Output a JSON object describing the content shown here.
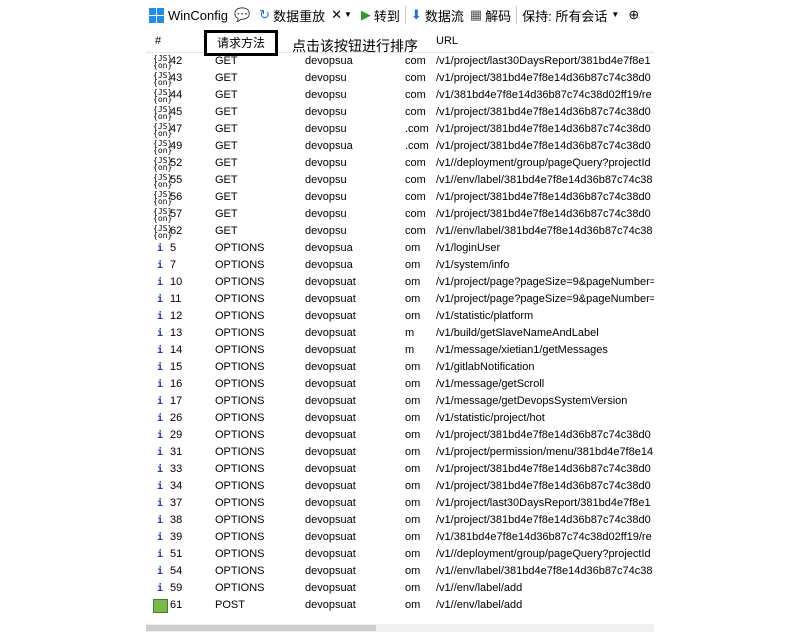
{
  "toolbar": {
    "winconfig": "WinConfig",
    "replay": "数据重放",
    "remove": "✕",
    "goto": "转到",
    "stream": "数据流",
    "decode": "解码",
    "keep": "保持: 所有会话"
  },
  "columns": {
    "num": "#",
    "method": "请求方法",
    "url": "URL"
  },
  "annotation": "点击该按钮进行排序",
  "rows": [
    {
      "icon": "json",
      "num": "42",
      "method": "GET",
      "host": "devopsua",
      "domain": "com",
      "url": "/v1/project/last30DaysReport/381bd4e7f8e1"
    },
    {
      "icon": "json",
      "num": "43",
      "method": "GET",
      "host": "devopsu",
      "domain": "com",
      "url": "/v1/project/381bd4e7f8e14d36b87c74c38d0"
    },
    {
      "icon": "json",
      "num": "44",
      "method": "GET",
      "host": "devopsu",
      "domain": "com",
      "url": "/v1/381bd4e7f8e14d36b87c74c38d02ff19/re"
    },
    {
      "icon": "json",
      "num": "45",
      "method": "GET",
      "host": "devopsu",
      "domain": "com",
      "url": "/v1/project/381bd4e7f8e14d36b87c74c38d0"
    },
    {
      "icon": "json",
      "num": "47",
      "method": "GET",
      "host": "devopsu",
      "domain": ".com",
      "url": "/v1/project/381bd4e7f8e14d36b87c74c38d0"
    },
    {
      "icon": "json",
      "num": "49",
      "method": "GET",
      "host": "devopsua",
      "domain": ".com",
      "url": "/v1/project/381bd4e7f8e14d36b87c74c38d0"
    },
    {
      "icon": "json",
      "num": "52",
      "method": "GET",
      "host": "devopsu",
      "domain": "com",
      "url": "/v1//deployment/group/pageQuery?projectId"
    },
    {
      "icon": "json",
      "num": "55",
      "method": "GET",
      "host": "devopsu",
      "domain": "com",
      "url": "/v1//env/label/381bd4e7f8e14d36b87c74c38"
    },
    {
      "icon": "json",
      "num": "56",
      "method": "GET",
      "host": "devopsu",
      "domain": "com",
      "url": "/v1/project/381bd4e7f8e14d36b87c74c38d0"
    },
    {
      "icon": "json",
      "num": "57",
      "method": "GET",
      "host": "devopsu",
      "domain": "com",
      "url": "/v1/project/381bd4e7f8e14d36b87c74c38d0"
    },
    {
      "icon": "json",
      "num": "62",
      "method": "GET",
      "host": "devopsu",
      "domain": "com",
      "url": "/v1//env/label/381bd4e7f8e14d36b87c74c38"
    },
    {
      "icon": "info",
      "num": "5",
      "method": "OPTIONS",
      "host": "devopsua",
      "domain": "om",
      "url": "/v1/loginUser"
    },
    {
      "icon": "info",
      "num": "7",
      "method": "OPTIONS",
      "host": "devopsua",
      "domain": "om",
      "url": "/v1/system/info"
    },
    {
      "icon": "info",
      "num": "10",
      "method": "OPTIONS",
      "host": "devopsuat",
      "domain": "om",
      "url": "/v1/project/page?pageSize=9&pageNumber="
    },
    {
      "icon": "info",
      "num": "11",
      "method": "OPTIONS",
      "host": "devopsuat",
      "domain": "om",
      "url": "/v1/project/page?pageSize=9&pageNumber="
    },
    {
      "icon": "info",
      "num": "12",
      "method": "OPTIONS",
      "host": "devopsuat",
      "domain": "om",
      "url": "/v1/statistic/platform"
    },
    {
      "icon": "info",
      "num": "13",
      "method": "OPTIONS",
      "host": "devopsuat",
      "domain": "m",
      "url": "/v1/build/getSlaveNameAndLabel"
    },
    {
      "icon": "info",
      "num": "14",
      "method": "OPTIONS",
      "host": "devopsuat",
      "domain": "m",
      "url": "/v1/message/xietian1/getMessages"
    },
    {
      "icon": "info",
      "num": "15",
      "method": "OPTIONS",
      "host": "devopsuat",
      "domain": "om",
      "url": "/v1/gitlabNotification"
    },
    {
      "icon": "info",
      "num": "16",
      "method": "OPTIONS",
      "host": "devopsuat",
      "domain": "om",
      "url": "/v1/message/getScroll"
    },
    {
      "icon": "info",
      "num": "17",
      "method": "OPTIONS",
      "host": "devopsuat",
      "domain": "om",
      "url": "/v1/message/getDevopsSystemVersion"
    },
    {
      "icon": "info",
      "num": "26",
      "method": "OPTIONS",
      "host": "devopsuat",
      "domain": "om",
      "url": "/v1/statistic/project/hot"
    },
    {
      "icon": "info",
      "num": "29",
      "method": "OPTIONS",
      "host": "devopsuat",
      "domain": "om",
      "url": "/v1/project/381bd4e7f8e14d36b87c74c38d0"
    },
    {
      "icon": "info",
      "num": "31",
      "method": "OPTIONS",
      "host": "devopsuat",
      "domain": "om",
      "url": "/v1/project/permission/menu/381bd4e7f8e14"
    },
    {
      "icon": "info",
      "num": "33",
      "method": "OPTIONS",
      "host": "devopsuat",
      "domain": "om",
      "url": "/v1/project/381bd4e7f8e14d36b87c74c38d0"
    },
    {
      "icon": "info",
      "num": "34",
      "method": "OPTIONS",
      "host": "devopsuat",
      "domain": "om",
      "url": "/v1/project/381bd4e7f8e14d36b87c74c38d0"
    },
    {
      "icon": "info",
      "num": "37",
      "method": "OPTIONS",
      "host": "devopsuat",
      "domain": "om",
      "url": "/v1/project/last30DaysReport/381bd4e7f8e1"
    },
    {
      "icon": "info",
      "num": "38",
      "method": "OPTIONS",
      "host": "devopsuat",
      "domain": "om",
      "url": "/v1/project/381bd4e7f8e14d36b87c74c38d0"
    },
    {
      "icon": "info",
      "num": "39",
      "method": "OPTIONS",
      "host": "devopsuat",
      "domain": "om",
      "url": "/v1/381bd4e7f8e14d36b87c74c38d02ff19/re"
    },
    {
      "icon": "info",
      "num": "51",
      "method": "OPTIONS",
      "host": "devopsuat",
      "domain": "om",
      "url": "/v1//deployment/group/pageQuery?projectId"
    },
    {
      "icon": "info",
      "num": "54",
      "method": "OPTIONS",
      "host": "devopsuat",
      "domain": "om",
      "url": "/v1//env/label/381bd4e7f8e14d36b87c74c38"
    },
    {
      "icon": "info",
      "num": "59",
      "method": "OPTIONS",
      "host": "devopsuat",
      "domain": "om",
      "url": "/v1//env/label/add"
    },
    {
      "icon": "post",
      "num": "61",
      "method": "POST",
      "host": "devopsuat",
      "domain": "om",
      "url": "/v1//env/label/add"
    }
  ]
}
